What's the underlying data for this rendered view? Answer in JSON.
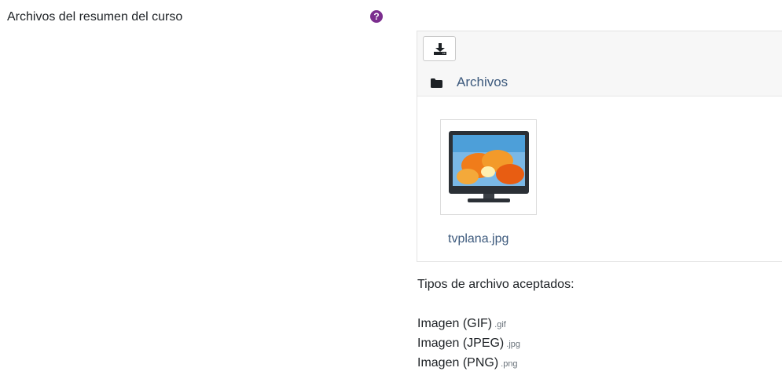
{
  "field": {
    "label": "Archivos del resumen del curso",
    "help_icon": "?"
  },
  "filemanager": {
    "toolbar": {
      "download_icon": "download-icon"
    },
    "breadcrumb": {
      "folder_icon": "folder-icon",
      "label": "Archivos"
    },
    "files": [
      {
        "name": "tvplana.jpg",
        "thumbnail_icon": "monitor-image-icon"
      }
    ]
  },
  "accepted_types": {
    "title": "Tipos de archivo aceptados:",
    "items": [
      {
        "name": "Imagen (GIF)",
        "ext": ".gif"
      },
      {
        "name": "Imagen (JPEG)",
        "ext": ".jpg"
      },
      {
        "name": "Imagen (PNG)",
        "ext": ".png"
      }
    ]
  },
  "colors": {
    "help_icon": "#7b2d8e",
    "link": "#3d5a7d",
    "toolbar_bg": "#f7f7f7"
  }
}
